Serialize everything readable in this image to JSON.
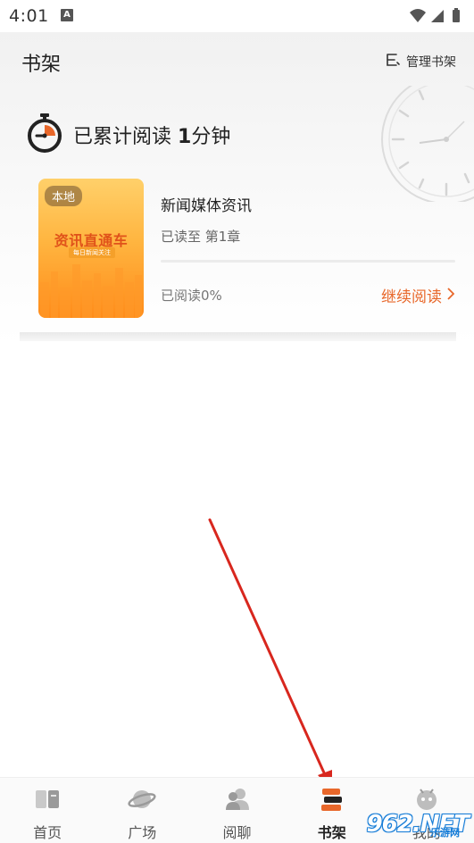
{
  "status": {
    "time": "4:01",
    "notif_letter": "A"
  },
  "header": {
    "title": "书架",
    "manage_label": "管理书架"
  },
  "reading_time": {
    "prefix": "已累计阅读 ",
    "amount": "1",
    "unit": "分钟"
  },
  "book": {
    "cover_tag": "本地",
    "cover_title": "资讯直通车",
    "cover_subtitle": "每日新闻关注",
    "name": "新闻媒体资讯",
    "chapter": "已读至 第1章",
    "percent_text": "已阅读0%",
    "continue_label": "继续阅读"
  },
  "tabs": [
    {
      "label": "首页",
      "icon": "book-icon",
      "active": false
    },
    {
      "label": "广场",
      "icon": "planet-icon",
      "active": false
    },
    {
      "label": "阅聊",
      "icon": "users-icon",
      "active": false
    },
    {
      "label": "书架",
      "icon": "bookshelf-icon",
      "active": true
    },
    {
      "label": "我的",
      "icon": "robot-icon",
      "active": false
    }
  ],
  "watermark": {
    "text": "962.NET",
    "sub": "乐游网"
  },
  "colors": {
    "accent": "#e8672a",
    "arrow": "#d8271e",
    "watermark_blue": "#1a7fd8"
  }
}
